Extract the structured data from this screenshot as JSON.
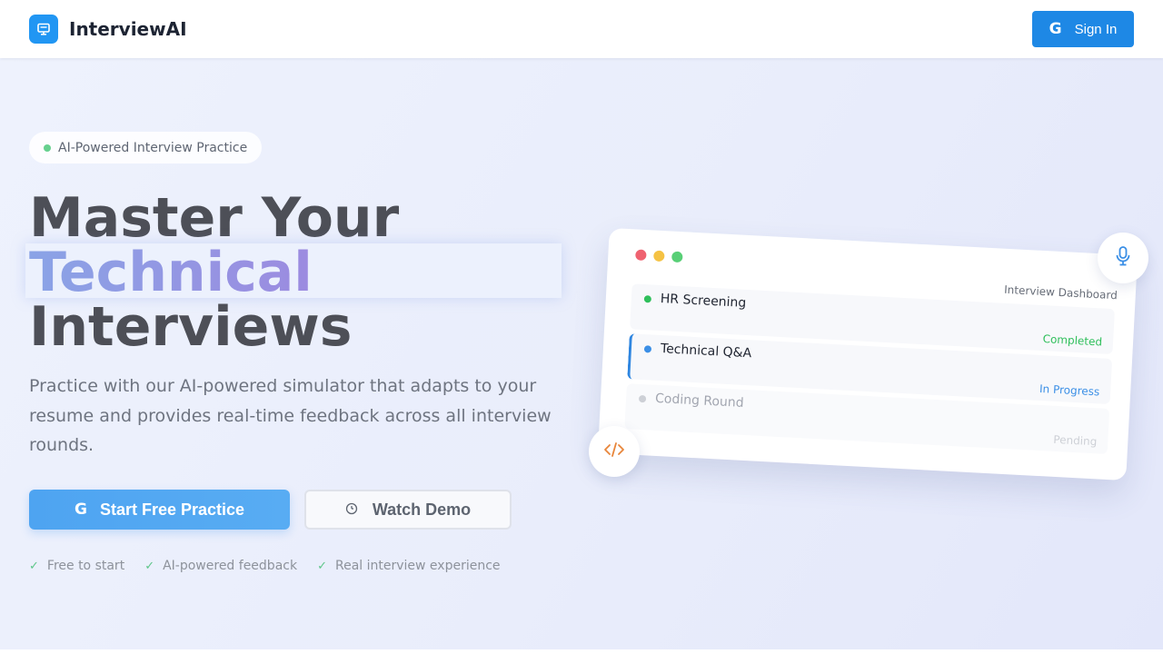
{
  "header": {
    "brand": "InterviewAI",
    "signin_label": "Sign In",
    "logo_icon": "monitor-icon",
    "google_icon": "G"
  },
  "hero": {
    "badge": "AI-Powered Interview Practice",
    "title_line1": "Master Your",
    "title_line2": "Technical",
    "title_line3": "Interviews",
    "description": "Practice with our AI-powered simulator that adapts to your resume and provides real-time feedback across all interview rounds.",
    "primary_cta": "Start Free Practice",
    "secondary_cta": "Watch Demo",
    "features": [
      "Free to start",
      "AI-powered feedback",
      "Real interview experience"
    ]
  },
  "dashboard": {
    "title": "Interview Dashboard",
    "rounds": [
      {
        "name": "HR Screening",
        "status": "Completed",
        "color": "#2fbf5b"
      },
      {
        "name": "Technical Q&A",
        "status": "In Progress",
        "color": "#3b8fe6"
      },
      {
        "name": "Coding Round",
        "status": "Pending",
        "color": "#b9bdc6"
      }
    ]
  },
  "colors": {
    "accent": "#1e88e5",
    "heading": "#4d4f57",
    "gradient_start": "#8aa3e6",
    "gradient_end": "#9c8be0"
  }
}
